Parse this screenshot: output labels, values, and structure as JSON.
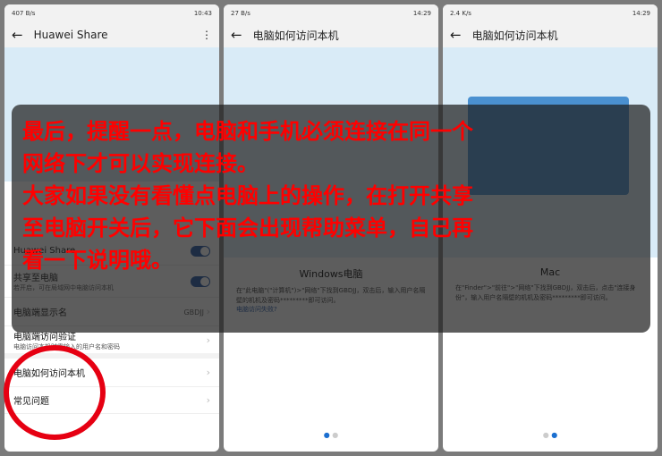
{
  "panel1": {
    "status_left": "407 B/s",
    "time": "10:43",
    "title": "Huawei Share",
    "items": [
      {
        "label": "Huawei Share"
      },
      {
        "label": "共享至电脑",
        "sub": "若开启，可在局域网中电脑访问本机"
      },
      {
        "label": "电脑端显示名",
        "value": "GBDJJ"
      },
      {
        "label": "电脑端访问验证",
        "sub": "电脑访问本机时需输入的用户名和密码"
      },
      {
        "label": "电脑如何访问本机"
      },
      {
        "label": "常见问题"
      }
    ]
  },
  "panel2": {
    "status_left": "27 B/s",
    "time": "14:29",
    "title": "电脑如何访问本机",
    "section": "Windows电脑",
    "desc": "在\"此电脑\"(\"计算机\")>\"网络\"下找到GBDJJ，双击后，输入用户名隔壁的机机及密码*********即可访问。",
    "link": "电脑访问失败?"
  },
  "panel3": {
    "status_left": "2.4 K/s",
    "time": "14:29",
    "title": "电脑如何访问本机",
    "section": "Mac",
    "desc": "在\"Finder\">\"前往\">\"网络\"下找到GBDJJ，双击后，点击\"连接身份\"，输入用户名隔壁的机机及密码*********即可访问。"
  },
  "overlay": {
    "lines": [
      "最后，提醒一点，电脑和手机必须连接在同一个",
      "网络下才可以实现连接。",
      "大家如果没有看懂点电脑上的操作，在打开共享",
      "至电脑开关后，它下面会出现帮助菜单，自己再",
      "看一下说明哦。"
    ]
  }
}
